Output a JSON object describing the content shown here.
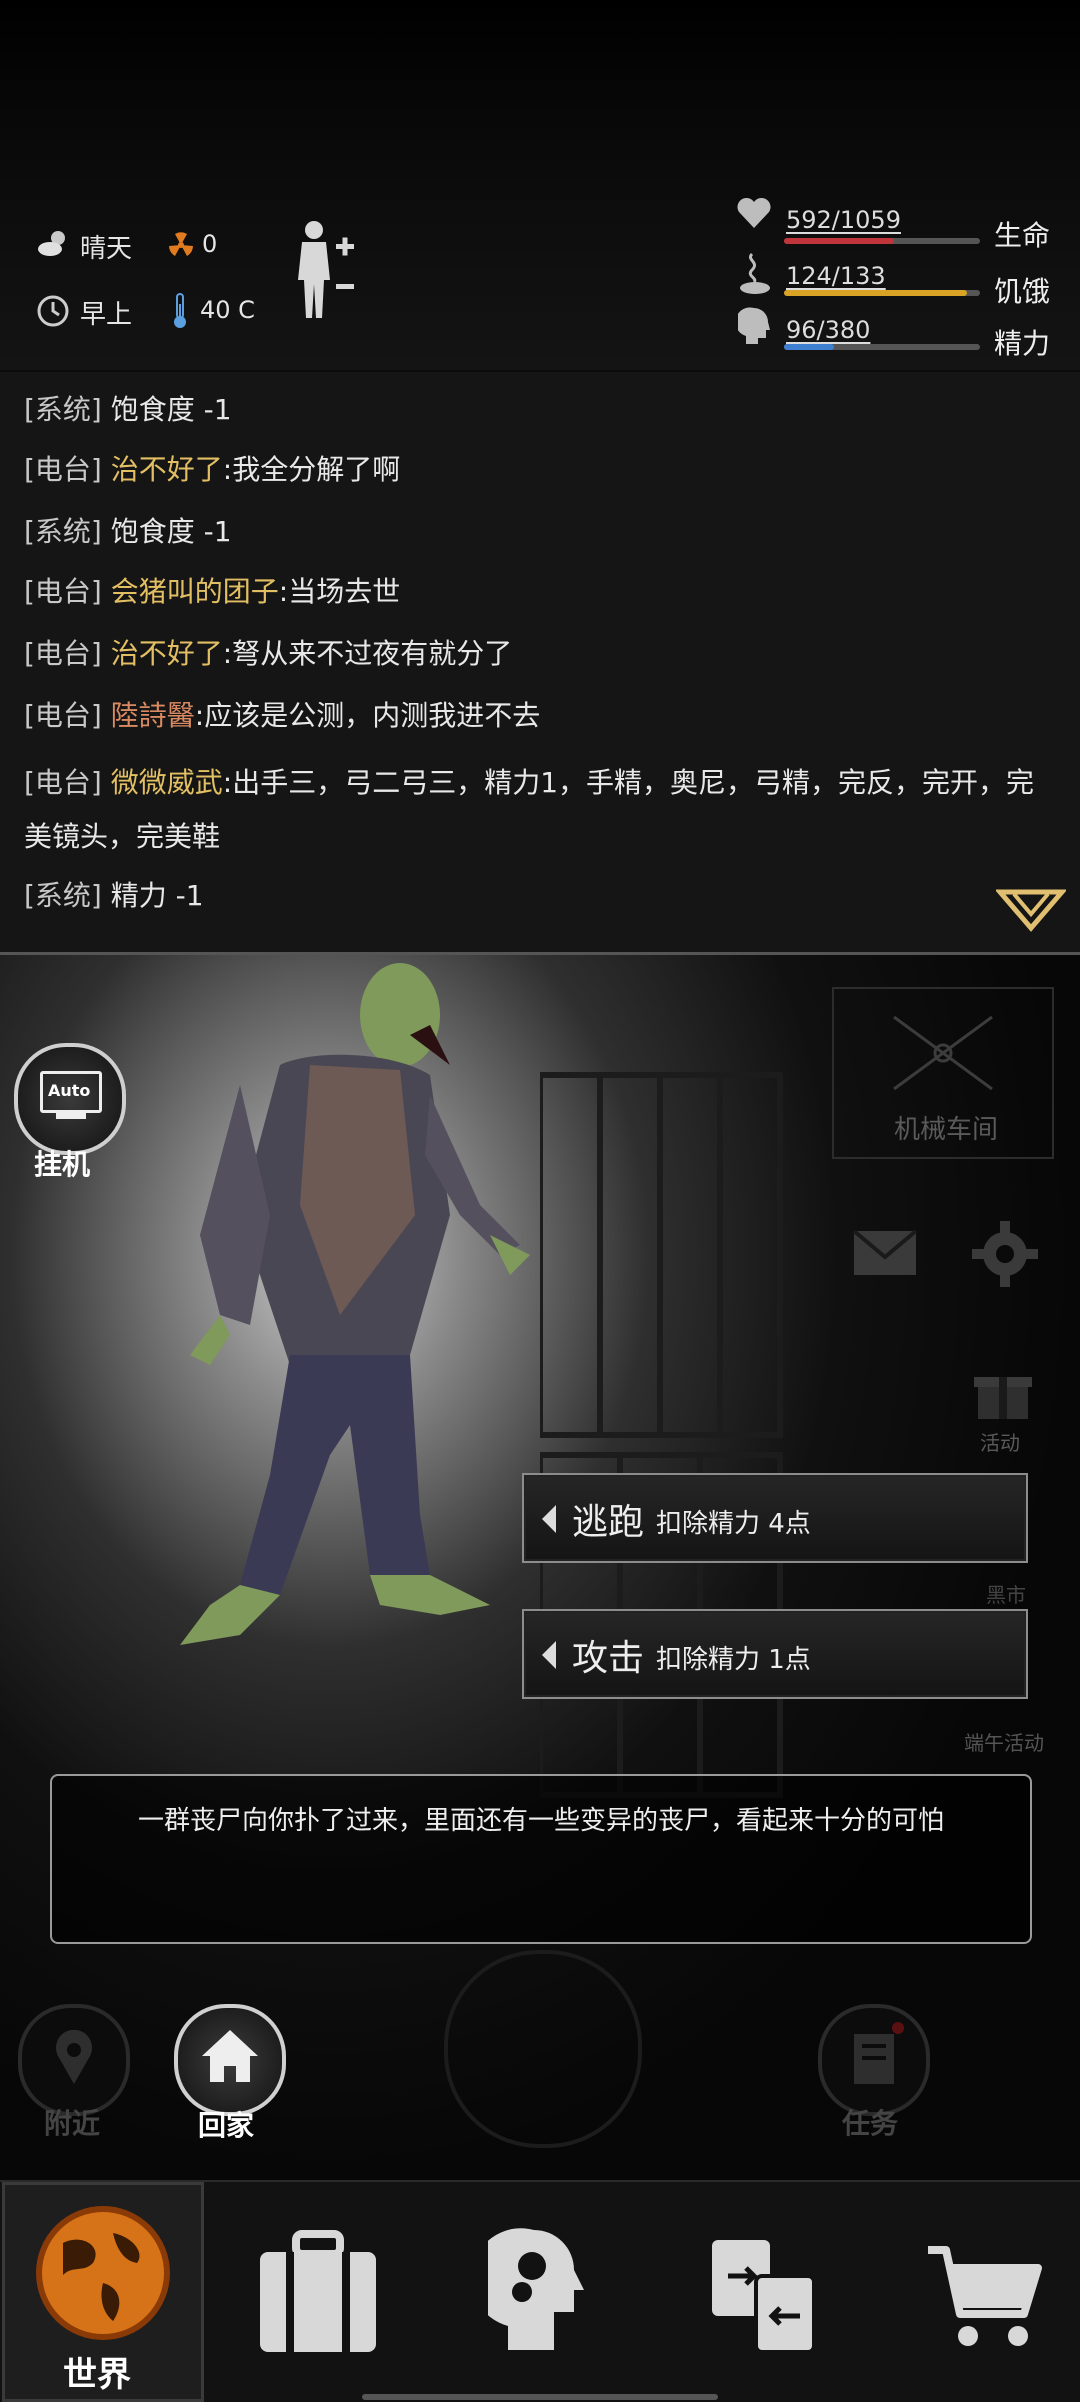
{
  "status": {
    "weather": "晴天",
    "radiation": "0",
    "time_of_day": "早上",
    "temperature": "40 C",
    "bars": [
      {
        "text": "592/1059",
        "value": 592,
        "max": 1059,
        "label": "生命",
        "color": "#c0343b"
      },
      {
        "text": "124/133",
        "value": 124,
        "max": 133,
        "label": "饥饿",
        "color": "#d9a326"
      },
      {
        "text": "96/380",
        "value": 96,
        "max": 380,
        "label": "精力",
        "color": "#3f7fd0"
      }
    ]
  },
  "log": [
    {
      "tag": "[系统]",
      "user": "",
      "text": "饱食度 -1"
    },
    {
      "tag": "[电台]",
      "user": "治不好了",
      "text": ":我全分解了啊"
    },
    {
      "tag": "[系统]",
      "user": "",
      "text": "饱食度 -1"
    },
    {
      "tag": "[电台]",
      "user": "会猪叫的团子",
      "text": ":当场去世"
    },
    {
      "tag": "[电台]",
      "user": "治不好了",
      "text": ":弩从来不过夜有就分了"
    },
    {
      "tag": "[电台]",
      "user": "陸詩醫",
      "text": ":应该是公测，内测我进不去"
    },
    {
      "tag": "[电台]",
      "user": "微微威武",
      "text": ":出手三，弓二弓三，精力1，手精，奥尼，弓精，完反，完开，完美镜头，完美鞋"
    },
    {
      "tag": "[系统]",
      "user": "",
      "text": "精力 -1"
    }
  ],
  "battle": {
    "auto_label": "挂机",
    "auto_text": "Auto",
    "workshop_label": "机械车间",
    "event_label": "活动",
    "market_label": "黑市",
    "dragon_boat_label": "端午活动",
    "actions": [
      {
        "label": "逃跑",
        "cost": "扣除精力 4点"
      },
      {
        "label": "攻击",
        "cost": "扣除精力 1点"
      }
    ],
    "message": "一群丧尸向你扑了过来，里面还有一些变异的丧尸，看起来十分的可怕",
    "nearby_label": "附近",
    "home_label": "回家",
    "task_label": "任务"
  },
  "nav": {
    "world_label": "世界"
  }
}
